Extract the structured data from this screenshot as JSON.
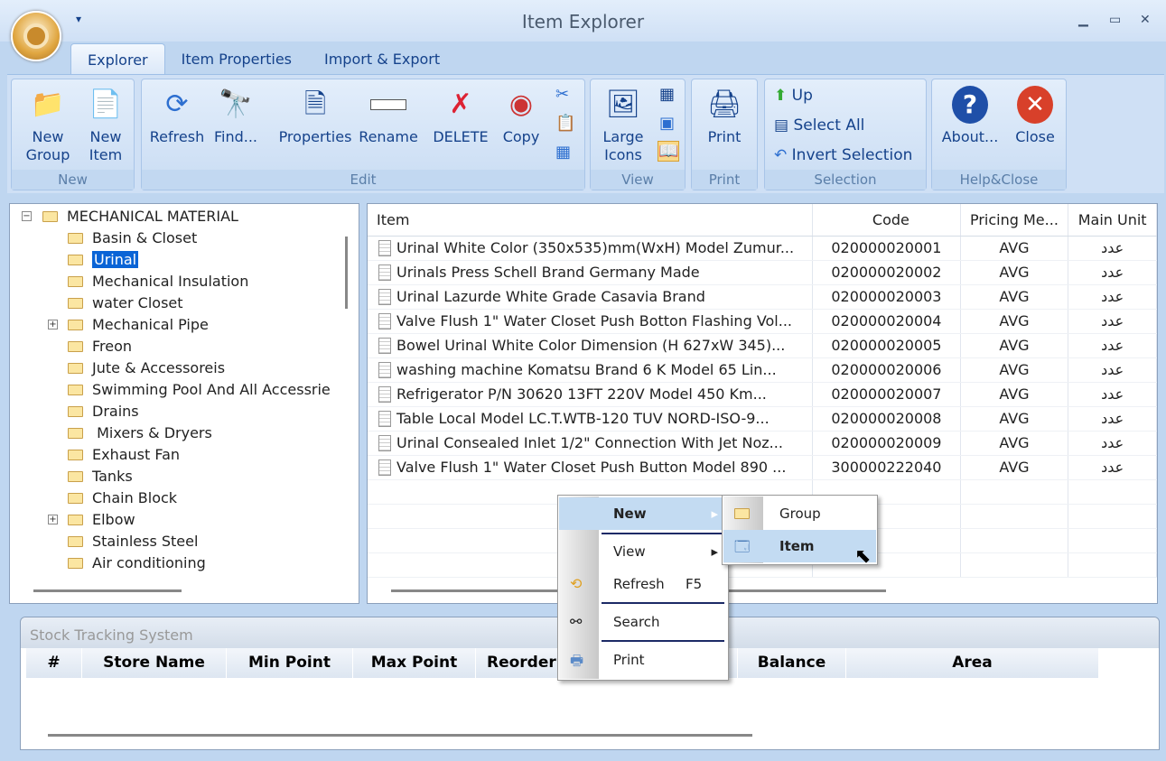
{
  "window": {
    "title": "Item Explorer",
    "minimize": "▁",
    "maximize": "▭",
    "close": "✕",
    "qat": "▾"
  },
  "tabs": [
    "Explorer",
    "Item Properties",
    "Import & Export"
  ],
  "ribbon": {
    "new": {
      "label": "New",
      "new_group": "New Group",
      "new_item": "New Item"
    },
    "edit": {
      "label": "Edit",
      "refresh": "Refresh",
      "find": "Find...",
      "properties": "Properties",
      "rename": "Rename",
      "delete": "DELETE",
      "copy": "Copy"
    },
    "view": {
      "label": "View",
      "large_icons": "Large Icons"
    },
    "print": {
      "label": "Print",
      "print": "Print"
    },
    "selection": {
      "label": "Selection",
      "up": "Up",
      "select_all": "Select All",
      "invert": "Invert Selection"
    },
    "help": {
      "label": "Help&Close",
      "about": "About...",
      "close": "Close"
    }
  },
  "tree": {
    "root": "MECHANICAL MATERIAL",
    "items": [
      "Basin & Closet",
      "Urinal",
      "Mechanical Insulation",
      "water Closet",
      "Mechanical Pipe",
      "Freon",
      "Jute & Accessoreis",
      "Swimming Pool And All Accessrie",
      "Drains",
      " Mixers & Dryers",
      "Exhaust Fan",
      "Tanks",
      "Chain Block",
      "Elbow",
      "Stainless Steel",
      "Air conditioning"
    ],
    "selected": "Urinal"
  },
  "list": {
    "columns": [
      "Item",
      "Code",
      "Pricing Me...",
      "Main Unit"
    ],
    "rows": [
      [
        "Urinal White Color (350x535)mm(WxH) Model Zumur...",
        "020000020001",
        "AVG",
        "عدد"
      ],
      [
        "Urinals Press Schell Brand Germany Made",
        "020000020002",
        "AVG",
        "عدد"
      ],
      [
        "Urinal Lazurde White Grade Casavia Brand",
        "020000020003",
        "AVG",
        "عدد"
      ],
      [
        "Valve Flush 1\" Water Closet Push Botton Flashing Vol...",
        "020000020004",
        "AVG",
        "عدد"
      ],
      [
        "Bowel Urinal White Color Dimension (H 627xW 345)...",
        "020000020005",
        "AVG",
        "عدد"
      ],
      [
        "washing machine  Komatsu Brand  6 K  Model 65 Lin...",
        "020000020006",
        "AVG",
        "عدد"
      ],
      [
        "Refrigerator  P/N 30620 13FT 220V Model 450   Km...",
        "020000020007",
        "AVG",
        "عدد"
      ],
      [
        "Table  Local Model LC.T.WTB-120 TUV NORD-ISO-9...",
        "020000020008",
        "AVG",
        "عدد"
      ],
      [
        "Urinal Consealed Inlet 1/2\" Connection With Jet Noz...",
        "020000020009",
        "AVG",
        "عدد"
      ],
      [
        "Valve Flush 1\" Water Closet Push Button Model 890 ...",
        "300000222040",
        "AVG",
        "عدد"
      ]
    ]
  },
  "stock": {
    "title": "Stock Tracking System",
    "columns": [
      "#",
      "Store Name",
      "Min Point",
      "Max Point",
      "Reorder",
      "Balance",
      "Area"
    ]
  },
  "context_menu": {
    "new": "New",
    "view": "View",
    "refresh": "Refresh",
    "refresh_key": "F5",
    "search": "Search",
    "print": "Print"
  },
  "submenu": {
    "group": "Group",
    "item": "Item"
  }
}
